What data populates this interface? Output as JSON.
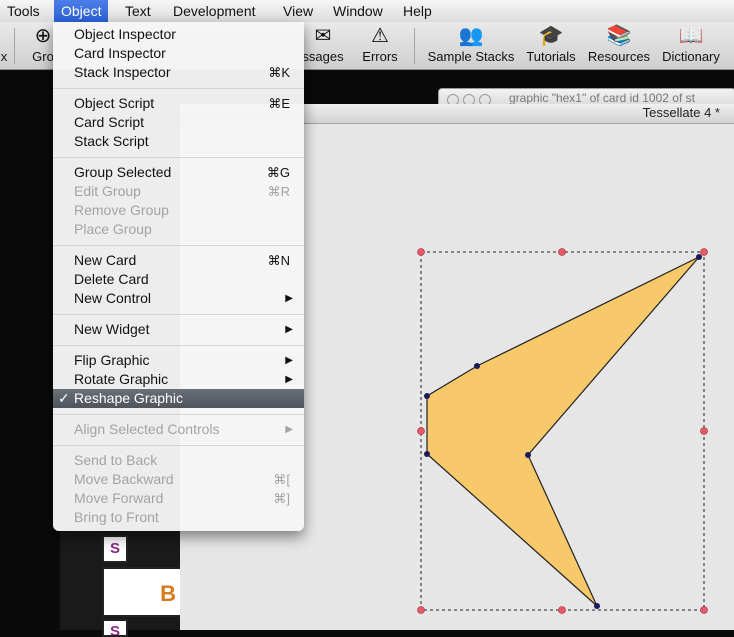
{
  "menubar": {
    "items": [
      "Tools",
      "Object",
      "Text",
      "Development",
      "View",
      "Window",
      "Help"
    ]
  },
  "toolbar": {
    "partial_left": "x",
    "group_partial": "Gro",
    "messages_partial": "ssages",
    "errors": "Errors",
    "sample_stacks": "Sample Stacks",
    "tutorials": "Tutorials",
    "resources": "Resources",
    "dictionary": "Dictionary"
  },
  "windows": {
    "back_title": "graphic \"hex1\" of card id 1002 of st",
    "main_title": "Tessellate 4 *"
  },
  "stack_cells": [
    "S",
    "B",
    "S"
  ],
  "menu": {
    "object_inspector": "Object Inspector",
    "card_inspector": "Card Inspector",
    "stack_inspector": "Stack Inspector",
    "stack_inspector_key": "⌘K",
    "object_script": "Object Script",
    "object_script_key": "⌘E",
    "card_script": "Card Script",
    "stack_script": "Stack Script",
    "group_selected": "Group Selected",
    "group_selected_key": "⌘G",
    "edit_group": "Edit Group",
    "edit_group_key": "⌘R",
    "remove_group": "Remove Group",
    "place_group": "Place Group",
    "new_card": "New Card",
    "new_card_key": "⌘N",
    "delete_card": "Delete Card",
    "new_control": "New Control",
    "new_widget": "New Widget",
    "flip_graphic": "Flip Graphic",
    "rotate_graphic": "Rotate Graphic",
    "reshape_graphic": "Reshape Graphic",
    "checkmark": "✓",
    "align_selected_controls": "Align Selected Controls",
    "send_to_back": "Send to Back",
    "move_backward": "Move Backward",
    "move_backward_key": "⌘[",
    "move_forward": "Move Forward",
    "move_forward_key": "⌘]",
    "bring_to_front": "Bring to Front",
    "submenu_arrow": "▶"
  },
  "colors": {
    "shape_fill": "#f7c96a",
    "selection_handle": "#e85a6a",
    "vertex": "#1a1a5a",
    "menu_highlight": "#4f545c"
  }
}
